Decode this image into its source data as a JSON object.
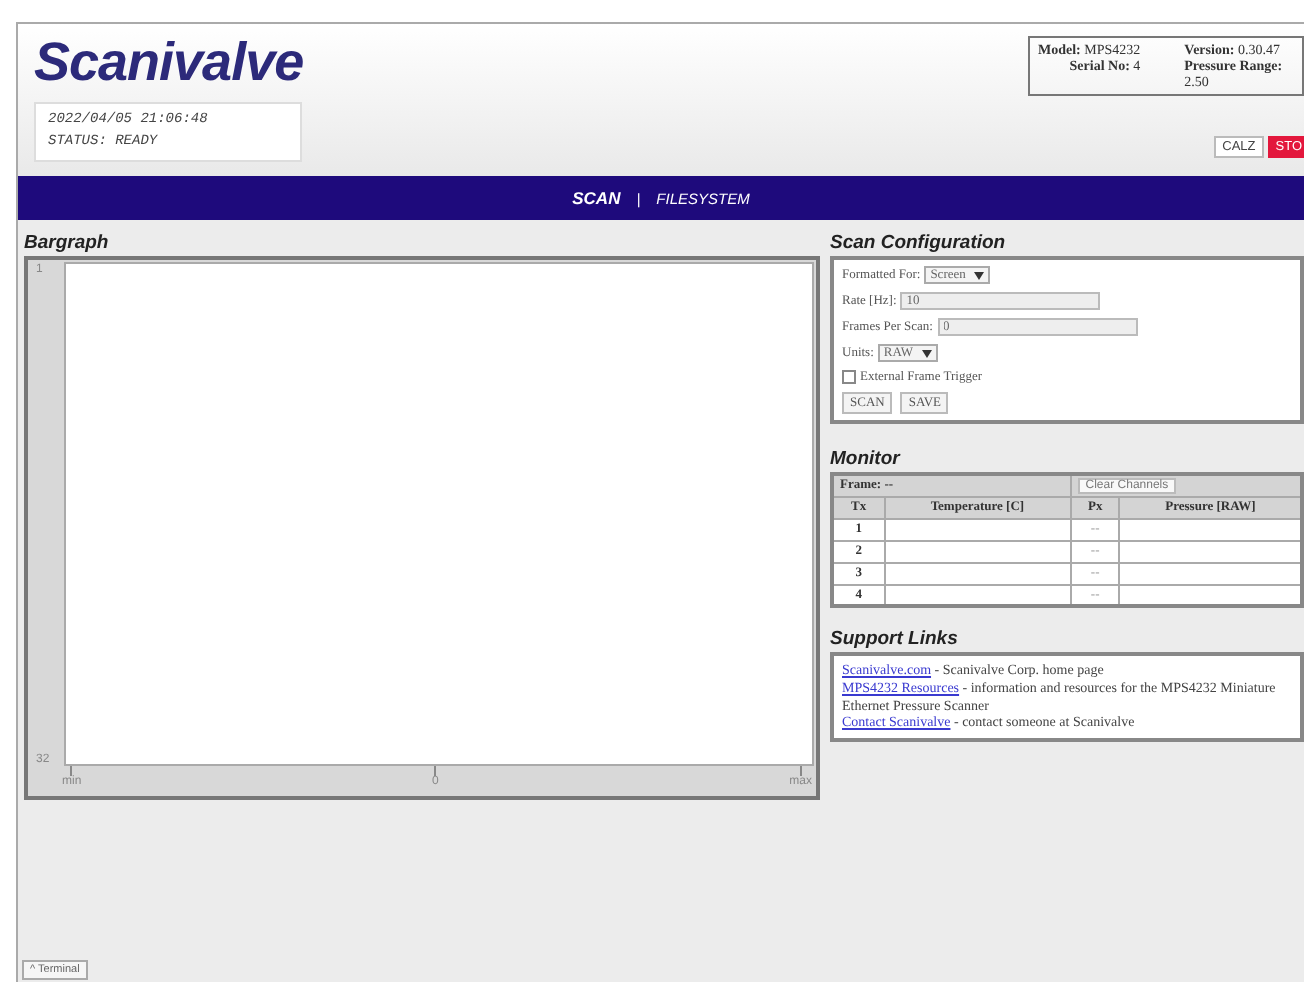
{
  "header": {
    "logo": "Scanivalve",
    "clock": "2022/04/05 21:06:48",
    "status": "STATUS: READY",
    "info": [
      "**Model:** MPS4232",
      "**Version:** 0.30.47",
      "**Serial No:** 4",
      "**Pressure Range:** 2.50"
    ],
    "buttons": [
      {
        "label": "CALZ",
        "kind": "plain"
      },
      {
        "label": "STO",
        "kind": "danger"
      }
    ]
  },
  "nav": {
    "tabs": [
      {
        "label": "SCAN",
        "selected": true
      },
      {
        "label": "FILESYSTEM",
        "selected": false
      }
    ],
    "separator": "|"
  },
  "bargraph": {
    "title": "Bargraph",
    "y_labels": [
      "1",
      "32"
    ],
    "x_labels": [
      "min",
      "0",
      "max"
    ]
  },
  "scan_config": {
    "title": "Scan Configuration",
    "fields": [
      {
        "kind": "select",
        "label": "Formatted For:",
        "value": "Screen"
      },
      {
        "kind": "input",
        "label": "Rate [Hz]:",
        "value": "10",
        "disabled": true
      },
      {
        "kind": "input",
        "label": "Frames Per Scan:",
        "value": "0",
        "disabled": true
      },
      {
        "kind": "select",
        "label": "Units:",
        "value": "RAW"
      },
      {
        "kind": "checkbox",
        "label": "External Frame Trigger",
        "checked": false
      }
    ],
    "buttons": [
      "SCAN",
      "SAVE"
    ]
  },
  "monitor": {
    "title": "Monitor",
    "frame": "**Frame:** --",
    "clear_button": "Clear Channels",
    "columns": [
      "Tx",
      "Temperature [C]",
      "Px",
      "Pressure [RAW]"
    ],
    "rows": [
      {
        "tx": "1",
        "px": "--"
      },
      {
        "tx": "2",
        "px": "--"
      },
      {
        "tx": "3",
        "px": "--"
      },
      {
        "tx": "4",
        "px": "--"
      }
    ]
  },
  "support": {
    "title": "Support Links",
    "items": [
      {
        "link": "Scanivalve.com",
        "text": " - Scanivalve Corp. home page"
      },
      {
        "link": "MPS4232 Resources",
        "text": " - information and resources for the MPS4232 Miniature Ethernet Pressure Scanner"
      },
      {
        "link": "Contact Scanivalve",
        "text": " - contact someone at Scanivalve"
      }
    ]
  },
  "terminal_button": "^ Terminal"
}
